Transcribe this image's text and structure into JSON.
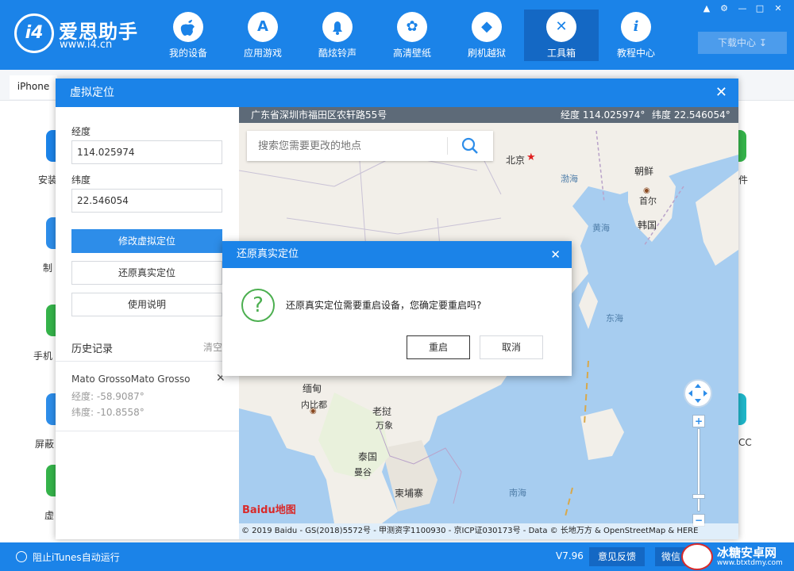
{
  "app": {
    "brand": "爱思助手",
    "url": "www.i4.cn",
    "logo_text": "i4"
  },
  "nav": [
    {
      "label": "我的设备",
      "icon": "apple-icon",
      "glyph": ""
    },
    {
      "label": "应用游戏",
      "icon": "app-store-icon",
      "glyph": "A"
    },
    {
      "label": "酷炫铃声",
      "icon": "bell-icon",
      "glyph": "♪"
    },
    {
      "label": "高清壁纸",
      "icon": "flower-icon",
      "glyph": "✿"
    },
    {
      "label": "刷机越狱",
      "icon": "box-icon",
      "glyph": "◆"
    },
    {
      "label": "工具箱",
      "icon": "tools-icon",
      "glyph": "✕"
    },
    {
      "label": "教程中心",
      "icon": "info-icon",
      "glyph": "i"
    }
  ],
  "header": {
    "download_label": "下载中心"
  },
  "device_tab": "iPhone",
  "bg_labels": {
    "install": "安装",
    "make": "制",
    "phone": "手机",
    "block": "屏蔽",
    "virtual": "虚",
    "right1": "件",
    "right2": "CC"
  },
  "dialog": {
    "title": "虚拟定位",
    "longitude_label": "经度",
    "longitude_value": "114.025974",
    "latitude_label": "纬度",
    "latitude_value": "22.546054",
    "modify_btn": "修改虚拟定位",
    "restore_btn": "还原真实定位",
    "help_btn": "使用说明",
    "history_label": "历史记录",
    "clear_label": "清空",
    "history": [
      {
        "name": "Mato GrossoMato Grosso",
        "lon": "经度: -58.9087°",
        "lat": "纬度: -10.8558°"
      }
    ]
  },
  "map": {
    "address": "广东省深圳市福田区农轩路55号",
    "lon_text": "经度 114.025974°",
    "lat_text": "纬度 22.546054°",
    "search_placeholder": "搜索您需要更改的地点",
    "labels": {
      "beijing": "北京",
      "bohai": "渤海",
      "korea_n": "朝鲜",
      "seoul": "首尔",
      "korea": "韩国",
      "yellow_sea": "黄海",
      "east_sea": "东海",
      "myanmar": "缅甸",
      "naypyidaw": "内比都",
      "laos": "老挝",
      "vientiane": "万象",
      "thailand": "泰国",
      "bangkok": "曼谷",
      "cambodia": "柬埔寨",
      "south_sea": "南海"
    },
    "copyright": "© 2019 Baidu - GS(2018)5572号 - 甲测资字1100930 - 京ICP证030173号 - Data © 长地万方 & OpenStreetMap & HERE",
    "baidu_logo": "Baidu地图"
  },
  "confirm": {
    "title": "还原真实定位",
    "message": "还原真实定位需要重启设备，您确定要重启吗?",
    "ok": "重启",
    "cancel": "取消"
  },
  "footer": {
    "itunes_label": "阻止iTunes自动运行",
    "version": "V7.96",
    "feedback": "意见反馈",
    "wechat": "微信",
    "watermark": "冰糖安卓网",
    "watermark_url": "www.btxtdmy.com"
  },
  "colors": {
    "primary": "#1b83e8",
    "button": "#2d8de9",
    "confirm_icon": "#4caf50"
  }
}
